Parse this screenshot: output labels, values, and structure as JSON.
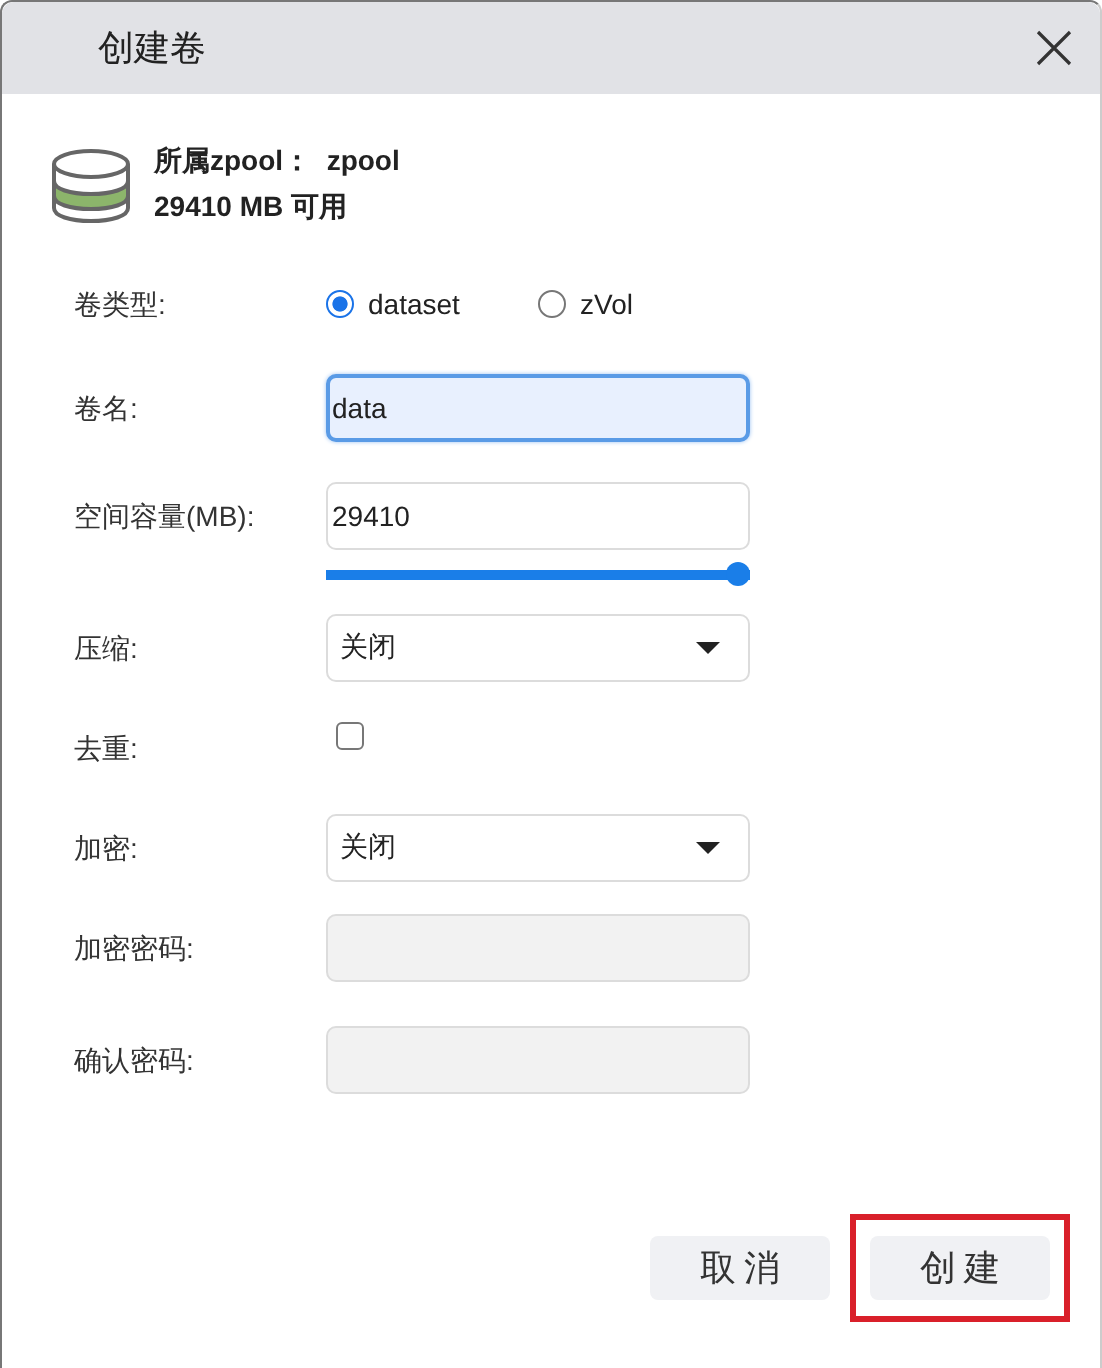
{
  "window": {
    "title": "创建卷"
  },
  "pool_info": {
    "pool_line": "所属zpool：  zpool",
    "free_line": "29410 MB 可用"
  },
  "form_rows": [
    {
      "kind": "radio",
      "label": "卷类型:",
      "options": [
        {
          "label": "dataset",
          "selected": true
        },
        {
          "label": "zVol",
          "selected": false
        }
      ]
    },
    {
      "kind": "text",
      "label": "卷名:",
      "value": "data",
      "focused": true
    },
    {
      "kind": "slider",
      "label": "空间容量(MB):",
      "value": "29410",
      "level": 1
    },
    {
      "kind": "select",
      "label": "压缩:",
      "value": "关闭"
    },
    {
      "kind": "checkbox",
      "label": "去重:",
      "checked": false
    },
    {
      "kind": "select",
      "label": "加密:",
      "value": "关闭"
    },
    {
      "kind": "password",
      "label": "加密密码:",
      "disabled": true
    },
    {
      "kind": "password",
      "label": "确认密码:",
      "disabled": true
    }
  ],
  "buttons": [
    {
      "label": "取消",
      "highlighted": false
    },
    {
      "label": "创建",
      "highlighted": true
    }
  ]
}
